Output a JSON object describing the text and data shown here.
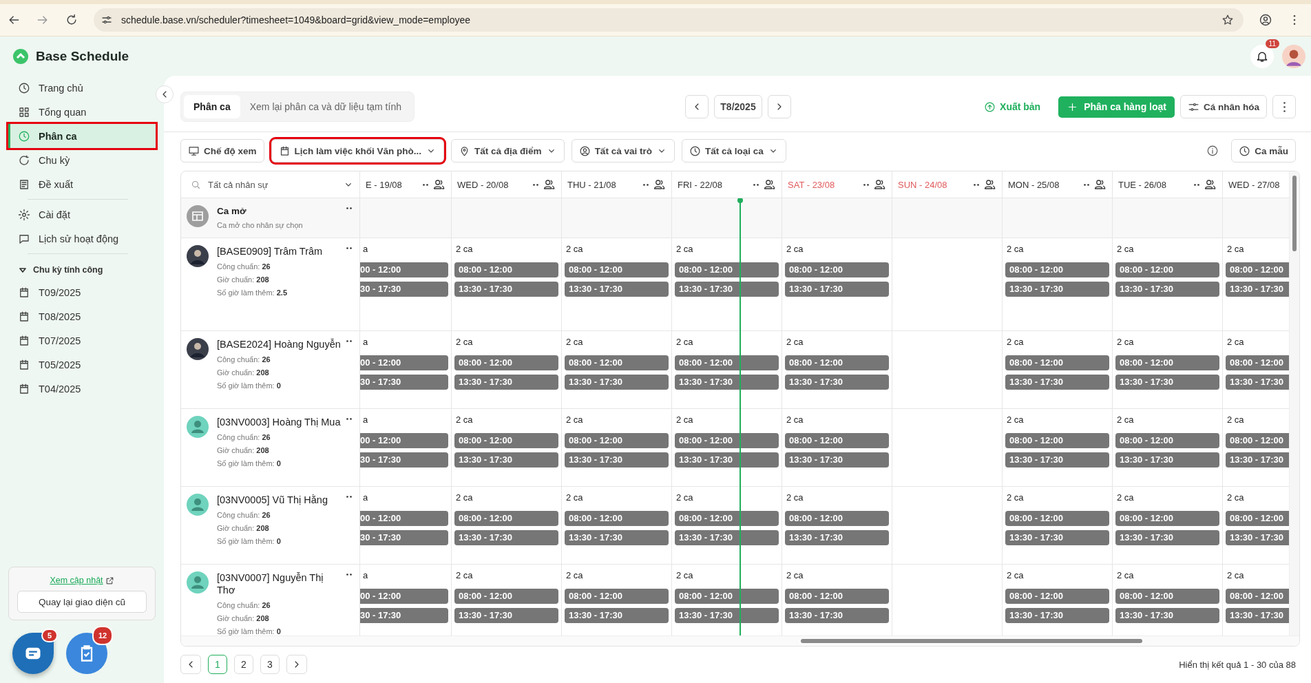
{
  "browser": {
    "url": "schedule.base.vn/scheduler?timesheet=1049&board=grid&view_mode=employee"
  },
  "app": {
    "title": "Base Schedule",
    "notifications": "11"
  },
  "sidebar": {
    "sections": [
      [
        {
          "label": "Trang chủ",
          "selected": false,
          "highlighted": false
        },
        {
          "label": "Tổng quan",
          "selected": false,
          "highlighted": false
        },
        {
          "label": "Phân ca",
          "selected": true,
          "highlighted": true
        },
        {
          "label": "Chu kỳ",
          "selected": false,
          "highlighted": false
        },
        {
          "label": "Đề xuất",
          "selected": false,
          "highlighted": false
        }
      ],
      [
        {
          "label": "Cài đặt",
          "selected": false,
          "highlighted": false
        },
        {
          "label": "Lịch sử hoạt động",
          "selected": false,
          "highlighted": false
        }
      ]
    ],
    "group": {
      "label": "Chu kỳ tính công",
      "expanded": true,
      "items": [
        "T09/2025",
        "T08/2025",
        "T07/2025",
        "T05/2025",
        "T04/2025"
      ]
    },
    "update_link": "Xem cập nhật",
    "legacy_button": "Quay lại giao diện cũ",
    "fabs": [
      {
        "kind": "chat",
        "badge": "5"
      },
      {
        "kind": "tasks",
        "badge": "12"
      }
    ]
  },
  "tabs": [
    {
      "label": "Phân ca",
      "selected": true
    },
    {
      "label": "Xem lại phân ca và dữ liệu tạm tính",
      "selected": false
    }
  ],
  "period": {
    "label": "T8/2025"
  },
  "actions": {
    "publish": "Xuất bản",
    "bulk": "Phân ca hàng loạt",
    "customize": "Cá nhân hóa"
  },
  "filters": [
    {
      "label": "Chế độ xem",
      "dropdown": false,
      "highlighted": false
    },
    {
      "label": "Lịch làm việc khối Văn phò...",
      "dropdown": true,
      "highlighted": true
    },
    {
      "label": "Tất cả địa điểm",
      "dropdown": true,
      "highlighted": false
    },
    {
      "label": "Tất cả vai trò",
      "dropdown": true,
      "highlighted": false
    },
    {
      "label": "Tất cả loại ca",
      "dropdown": true,
      "highlighted": false
    }
  ],
  "template_button": "Ca mẫu",
  "grid": {
    "search_placeholder": "Tất cả nhân sự",
    "days": [
      {
        "label": "E - 19/08",
        "cut": true,
        "weekend": false,
        "today": false
      },
      {
        "label": "WED - 20/08",
        "cut": false,
        "weekend": false,
        "today": false
      },
      {
        "label": "THU - 21/08",
        "cut": false,
        "weekend": false,
        "today": false
      },
      {
        "label": "FRI - 22/08",
        "cut": false,
        "weekend": false,
        "today": true
      },
      {
        "label": "SAT - 23/08",
        "cut": false,
        "weekend": true,
        "today": false
      },
      {
        "label": "SUN - 24/08",
        "cut": false,
        "weekend": true,
        "today": false
      },
      {
        "label": "MON - 25/08",
        "cut": false,
        "weekend": false,
        "today": false
      },
      {
        "label": "TUE - 26/08",
        "cut": false,
        "weekend": false,
        "today": false
      },
      {
        "label": "WED - 27/08",
        "cut": false,
        "weekend": false,
        "today": false
      }
    ],
    "open_shift": {
      "title": "Ca mở",
      "subtitle": "Ca mở cho nhân sự chọn"
    },
    "employees": [
      {
        "name": "[BASE0909] Trâm Trâm",
        "kind": "photo",
        "stats": [
          "Công chuẩn: **26**",
          "Giờ chuẩn: **208**",
          "Số giờ làm thêm: **2.5**"
        ],
        "cells": [
          {
            "kind": "shifts",
            "count": "a",
            "shifts": [
              "00 - 12:00",
              "30 - 17:30"
            ]
          },
          {
            "kind": "shifts",
            "count": "2 ca",
            "shifts": [
              "08:00 - 12:00",
              "13:30 - 17:30"
            ]
          },
          {
            "kind": "shifts",
            "count": "2 ca",
            "shifts": [
              "08:00 - 12:00",
              "13:30 - 17:30"
            ]
          },
          {
            "kind": "shifts",
            "count": "2 ca",
            "shifts": [
              "08:00 - 12:00",
              "13:30 - 17:30"
            ]
          },
          {
            "kind": "shifts",
            "count": "2 ca",
            "shifts": [
              "08:00 - 12:00",
              "13:30 - 17:30"
            ]
          },
          {
            "kind": "off"
          },
          {
            "kind": "shifts",
            "count": "2 ca",
            "shifts": [
              "08:00 - 12:00",
              "13:30 - 17:30"
            ]
          },
          {
            "kind": "shifts",
            "count": "2 ca",
            "shifts": [
              "08:00 - 12:00",
              "13:30 - 17:30"
            ]
          },
          {
            "kind": "shifts",
            "count": "2 ca",
            "shifts": [
              "08:00 - 12:00",
              "13:30 - 17:30"
            ]
          }
        ]
      },
      {
        "name": "[BASE2024] Hoàng Nguyễn",
        "kind": "photo",
        "stats": [
          "Công chuẩn: **26**",
          "Giờ chuẩn: **208**",
          "Số giờ làm thêm: **0**"
        ],
        "cells": [
          {
            "kind": "shifts",
            "count": "a",
            "shifts": [
              "00 - 12:00",
              "30 - 17:30"
            ]
          },
          {
            "kind": "shifts",
            "count": "2 ca",
            "shifts": [
              "08:00 - 12:00",
              "13:30 - 17:30"
            ]
          },
          {
            "kind": "shifts",
            "count": "2 ca",
            "shifts": [
              "08:00 - 12:00",
              "13:30 - 17:30"
            ]
          },
          {
            "kind": "shifts",
            "count": "2 ca",
            "shifts": [
              "08:00 - 12:00",
              "13:30 - 17:30"
            ]
          },
          {
            "kind": "shifts",
            "count": "2 ca",
            "shifts": [
              "08:00 - 12:00",
              "13:30 - 17:30"
            ]
          },
          {
            "kind": "off"
          },
          {
            "kind": "shifts",
            "count": "2 ca",
            "shifts": [
              "08:00 - 12:00",
              "13:30 - 17:30"
            ]
          },
          {
            "kind": "shifts",
            "count": "2 ca",
            "shifts": [
              "08:00 - 12:00",
              "13:30 - 17:30"
            ]
          },
          {
            "kind": "shifts",
            "count": "2 ca",
            "shifts": [
              "08:00 - 12:00",
              "13:30 - 17:30"
            ]
          }
        ]
      },
      {
        "name": "[03NV0003] Hoàng Thị Mua",
        "kind": "default",
        "stats": [
          "Công chuẩn: **26**",
          "Giờ chuẩn: **208**",
          "Số giờ làm thêm: **0**"
        ],
        "cells": [
          {
            "kind": "shifts",
            "count": "a",
            "shifts": [
              "00 - 12:00",
              "30 - 17:30"
            ]
          },
          {
            "kind": "shifts",
            "count": "2 ca",
            "shifts": [
              "08:00 - 12:00",
              "13:30 - 17:30"
            ]
          },
          {
            "kind": "shifts",
            "count": "2 ca",
            "shifts": [
              "08:00 - 12:00",
              "13:30 - 17:30"
            ]
          },
          {
            "kind": "shifts",
            "count": "2 ca",
            "shifts": [
              "08:00 - 12:00",
              "13:30 - 17:30"
            ]
          },
          {
            "kind": "shifts",
            "count": "2 ca",
            "shifts": [
              "08:00 - 12:00",
              "13:30 - 17:30"
            ]
          },
          {
            "kind": "off"
          },
          {
            "kind": "shifts",
            "count": "2 ca",
            "shifts": [
              "08:00 - 12:00",
              "13:30 - 17:30"
            ]
          },
          {
            "kind": "shifts",
            "count": "2 ca",
            "shifts": [
              "08:00 - 12:00",
              "13:30 - 17:30"
            ]
          },
          {
            "kind": "shifts",
            "count": "2 ca",
            "shifts": [
              "08:00 - 12:00",
              "13:30 - 17:30"
            ]
          }
        ]
      },
      {
        "name": "[03NV0005] Vũ Thị Hằng",
        "kind": "default",
        "stats": [
          "Công chuẩn: **26**",
          "Giờ chuẩn: **208**",
          "Số giờ làm thêm: **0**"
        ],
        "cells": [
          {
            "kind": "shifts",
            "count": "a",
            "shifts": [
              "00 - 12:00",
              "30 - 17:30"
            ]
          },
          {
            "kind": "shifts",
            "count": "2 ca",
            "shifts": [
              "08:00 - 12:00",
              "13:30 - 17:30"
            ]
          },
          {
            "kind": "shifts",
            "count": "2 ca",
            "shifts": [
              "08:00 - 12:00",
              "13:30 - 17:30"
            ]
          },
          {
            "kind": "shifts",
            "count": "2 ca",
            "shifts": [
              "08:00 - 12:00",
              "13:30 - 17:30"
            ]
          },
          {
            "kind": "shifts",
            "count": "2 ca",
            "shifts": [
              "08:00 - 12:00",
              "13:30 - 17:30"
            ]
          },
          {
            "kind": "off"
          },
          {
            "kind": "shifts",
            "count": "2 ca",
            "shifts": [
              "08:00 - 12:00",
              "13:30 - 17:30"
            ]
          },
          {
            "kind": "shifts",
            "count": "2 ca",
            "shifts": [
              "08:00 - 12:00",
              "13:30 - 17:30"
            ]
          },
          {
            "kind": "shifts",
            "count": "2 ca",
            "shifts": [
              "08:00 - 12:00",
              "13:30 - 17:30"
            ]
          }
        ]
      },
      {
        "name": "[03NV0007] Nguyễn Thị Thơ",
        "kind": "default",
        "stats": [
          "Công chuẩn: **26**",
          "Giờ chuẩn: **208**",
          "Số giờ làm thêm: **0**"
        ],
        "cells": [
          {
            "kind": "shifts",
            "count": "a",
            "shifts": [
              "00 - 12:00",
              "30 - 17:30"
            ]
          },
          {
            "kind": "shifts",
            "count": "2 ca",
            "shifts": [
              "08:00 - 12:00",
              "13:30 - 17:30"
            ]
          },
          {
            "kind": "shifts",
            "count": "2 ca",
            "shifts": [
              "08:00 - 12:00",
              "13:30 - 17:30"
            ]
          },
          {
            "kind": "shifts",
            "count": "2 ca",
            "shifts": [
              "08:00 - 12:00",
              "13:30 - 17:30"
            ]
          },
          {
            "kind": "shifts",
            "count": "2 ca",
            "shifts": [
              "08:00 - 12:00",
              "13:30 - 17:30"
            ]
          },
          {
            "kind": "off"
          },
          {
            "kind": "shifts",
            "count": "2 ca",
            "shifts": [
              "08:00 - 12:00",
              "13:30 - 17:30"
            ]
          },
          {
            "kind": "shifts",
            "count": "2 ca",
            "shifts": [
              "08:00 - 12:00",
              "13:30 - 17:30"
            ]
          },
          {
            "kind": "shifts",
            "count": "2 ca",
            "shifts": [
              "08:00 - 12:00",
              "13:30 - 17:30"
            ]
          }
        ]
      }
    ]
  },
  "pagination": {
    "pages": [
      {
        "label": "1",
        "selected": true
      },
      {
        "label": "2",
        "selected": false
      },
      {
        "label": "3",
        "selected": false
      }
    ],
    "summary": "Hiển thị kết quả 1 - 30 của 88"
  }
}
